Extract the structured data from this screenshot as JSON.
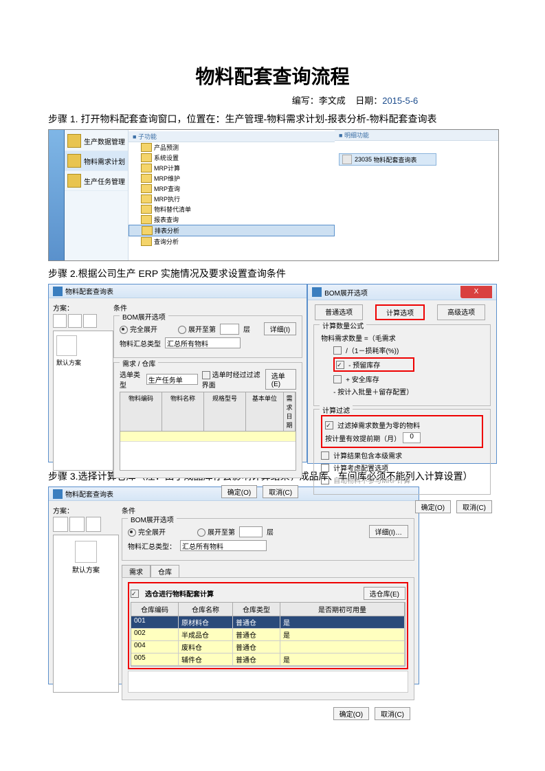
{
  "doc": {
    "title": "物料配套查询流程",
    "meta_author_label": "编写：",
    "meta_author": "李文成",
    "meta_date_label": "日期：",
    "meta_date": "2015-5-6",
    "step1": "步骤 1. 打开物料配套查询窗口，位置在：生产管理-物料需求计划-报表分析-物料配套查询表",
    "step2": "步骤 2.根据公司生产 ERP 实施情况及要求设置查询条件",
    "step3": "步骤 3.选择计算仓库（注：由于成品库存会影响计算结果，成品库、车间库必须不能列入计算设置）"
  },
  "shot1": {
    "nav": {
      "item1": "生产数据管理",
      "item2": "物料需求计划",
      "item3": "生产任务管理"
    },
    "tree_header": "子功能",
    "func_header": "明细功能",
    "tree": [
      "产品预测",
      "系统设置",
      "MRP计算",
      "MRP维护",
      "MRP查询",
      "MRP执行",
      "物料替代清单",
      "报表查询",
      "排表分析",
      "查询分析"
    ],
    "tree_selected": "排表分析",
    "func": {
      "item": "物料配套查询表",
      "code": "23035"
    }
  },
  "shot2": {
    "title": "物料配套查询表",
    "plan_label": "方案：",
    "default_plan": "默认方案",
    "cond_legend": "条件",
    "bom_group": "BOM展开选项",
    "radio_full": "完全展开",
    "radio_level": "展开至第",
    "level_suffix": "层",
    "sumtype_label": "物料汇总类型",
    "sumtype_value": "汇总所有物料",
    "detail_btn": "详细(I)",
    "group_demand": "需求 / 仓库",
    "select_type_label": "选单类型",
    "select_type_value": "生产任务单",
    "filter_check": "选单时经过过滤界面",
    "select_btn": "选单(E)",
    "tbl_headers": [
      "物料编码",
      "物料名称",
      "规格型号",
      "基本单位",
      "需求日期"
    ],
    "ok": "确定(O)",
    "cancel": "取消(C)"
  },
  "shot2r": {
    "title": "BOM展开选项",
    "close_x": "X",
    "tabs": [
      "普通选项",
      "计算选项",
      "高级选项"
    ],
    "grp_qty": "计算数量公式",
    "qty_label": "物料需求数量 =（毛需求",
    "rate_label": "/（1－损耗率(%))",
    "minus_stock": "- 预留库存",
    "plus_safety": "+ 安全库存",
    "round_label": "- 按计入批量＋留存配置）",
    "grp_filter": "计算过滤",
    "filter_zero": "过滤掉需求数量为零的物料",
    "lead_label": "按计量有效提前期（月）",
    "lead_value": "0",
    "calc_include": "计算结果包含本级需求",
    "consider_rule": "计算考虑配置选项",
    "auto_note": "自动物料不参与MRP计算"
  },
  "shot3": {
    "title": "物料配套查询表",
    "plan_label": "方案：",
    "default_plan": "默认方案",
    "cond_legend": "条件",
    "bom_group": "BOM展开选项",
    "radio_full": "完全展开",
    "radio_level": "展开至第",
    "level_suffix": "层",
    "detail_btn": "详细(I)…",
    "sumtype_label": "物料汇总类型：",
    "sumtype_value": "汇总所有物料",
    "tab_demand": "需求",
    "tab_stock": "仓库",
    "check_calc_stock": "选仓进行物料配套计算",
    "select_stock_btn": "选仓库(E)",
    "tbl_headers": [
      "仓库编码",
      "仓库名称",
      "仓库类型",
      "是否期初可用量"
    ],
    "rows": [
      {
        "code": "001",
        "name": "原材料仓",
        "type": "普通仓",
        "flag": "是"
      },
      {
        "code": "002",
        "name": "半成品仓",
        "type": "普通仓",
        "flag": "是"
      },
      {
        "code": "004",
        "name": "废料仓",
        "type": "普通仓",
        "flag": ""
      },
      {
        "code": "005",
        "name": "辅件仓",
        "type": "普通仓",
        "flag": "是"
      }
    ],
    "ok": "确定(O)",
    "cancel": "取消(C)"
  }
}
